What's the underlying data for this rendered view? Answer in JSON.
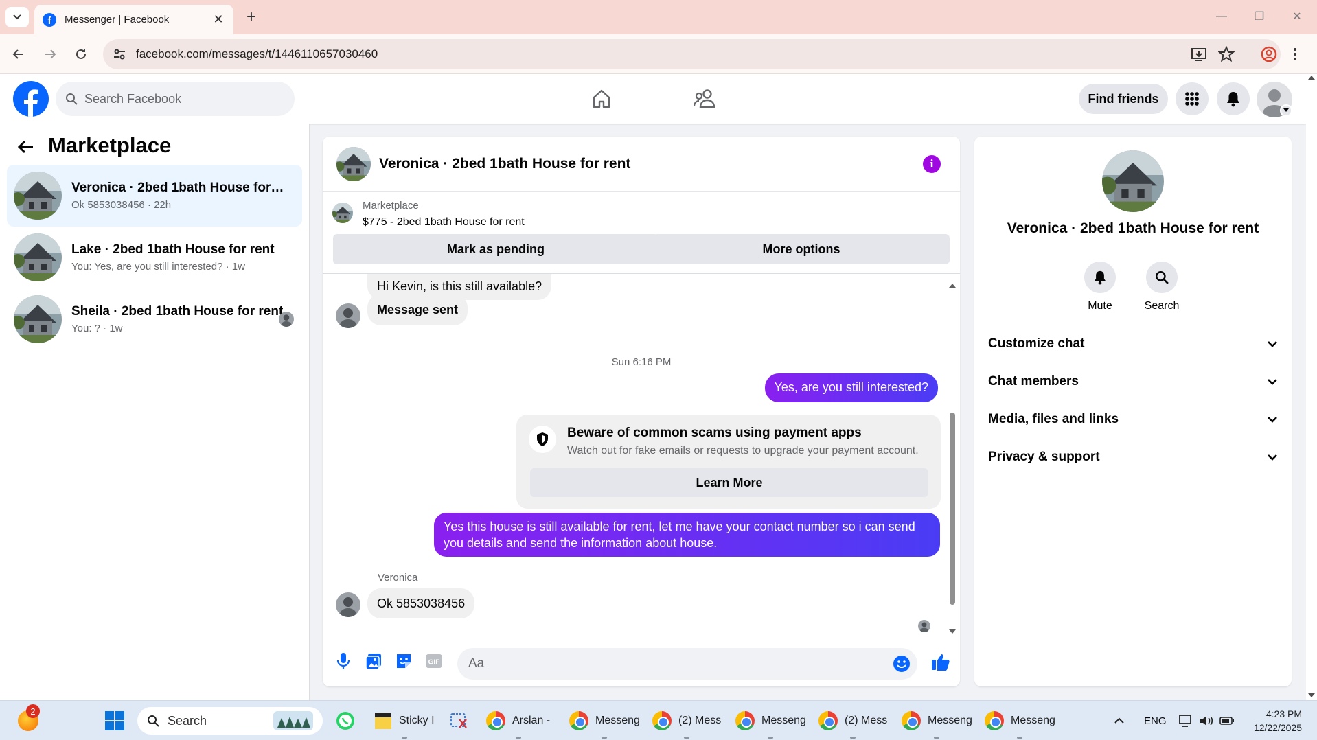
{
  "browser": {
    "tab_title": "Messenger | Facebook",
    "url": "facebook.com/messages/t/1446110657030460"
  },
  "fb_header": {
    "search_placeholder": "Search Facebook",
    "find_friends": "Find friends"
  },
  "left": {
    "title": "Marketplace",
    "conversations": [
      {
        "name": "Veronica · 2bed 1bath House for re...",
        "sub": "Ok 5853038456 · 22h"
      },
      {
        "name": "Lake · 2bed 1bath House for rent",
        "sub": "You: Yes, are you still interested? · 1w"
      },
      {
        "name": "Sheila · 2bed 1bath House for rent",
        "sub": "You: ? · 1w"
      }
    ]
  },
  "chat": {
    "title": "Veronica · 2bed 1bath House for rent",
    "marketplace_label": "Marketplace",
    "listing": "$775 - 2bed 1bath House for rent",
    "mark_pending": "Mark as pending",
    "more_options": "More options",
    "messages": [
      {
        "text": "Hi Kevin, is this still available?"
      },
      {
        "text": "Message sent"
      },
      {
        "text": "Sun 6:16 PM"
      },
      {
        "text": "Yes, are you still interested?"
      },
      {
        "text": "Yes this house is still available for rent, let me have your contact number so i can send you details and send the information about house."
      },
      {
        "text": "Veronica"
      },
      {
        "text": "Ok 5853038456"
      }
    ],
    "scam": {
      "title": "Beware of common scams using payment apps",
      "desc": "Watch out for fake emails or requests to upgrade your payment account.",
      "button": "Learn More"
    },
    "composer_placeholder": "Aa"
  },
  "info": {
    "name": "Veronica · 2bed 1bath House for rent",
    "mute": "Mute",
    "search": "Search",
    "rows": [
      "Customize chat",
      "Chat members",
      "Media, files and links",
      "Privacy & support"
    ]
  },
  "taskbar": {
    "badge": "2",
    "search": "Search",
    "apps": [
      "Sticky I",
      "Arslan -",
      "Messeng",
      "(2) Mess",
      "Messeng",
      "(2) Mess",
      "Messeng",
      "Messeng"
    ],
    "lang": "ENG",
    "time": "4:23 PM",
    "date": "12/22/2025"
  },
  "colors": {
    "fb_blue": "#0866ff",
    "outgoing_start": "#8a20f0",
    "outgoing_end": "#4a3cf5",
    "info_purple": "#9f08e0"
  }
}
